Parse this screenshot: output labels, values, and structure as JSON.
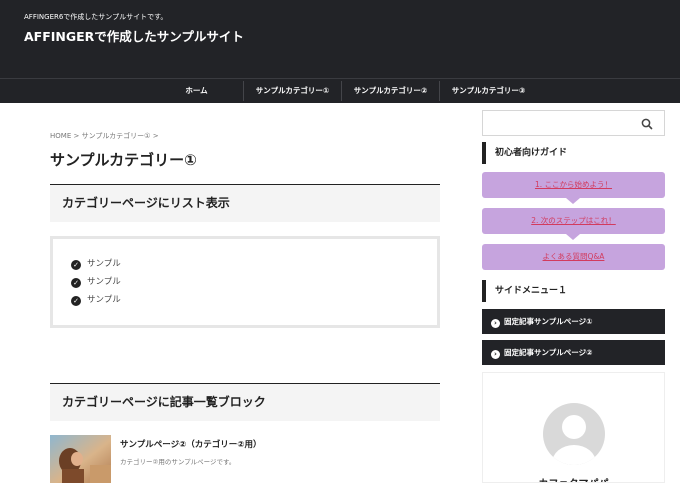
{
  "header": {
    "tagline": "AFFINGER6で作成したサンプルサイトです。",
    "site_title": "AFFINGERで作成したサンプルサイト",
    "bg_color": "#222327"
  },
  "nav": {
    "items": [
      {
        "label": "ホーム"
      },
      {
        "label": "サンプルカテゴリー①"
      },
      {
        "label": "サンプルカテゴリー②"
      },
      {
        "label": "サンプルカテゴリー③"
      }
    ]
  },
  "breadcrumb": {
    "items": [
      "HOME",
      "サンプルカテゴリー①"
    ],
    "separator": ">"
  },
  "main": {
    "category_title": "サンプルカテゴリー①",
    "section1_title": "カテゴリーページにリスト表示",
    "list_items": [
      "サンプル",
      "サンプル",
      "サンプル"
    ],
    "section2_title": "カテゴリーページに記事一覧ブロック",
    "post": {
      "title": "サンプルページ②（カテゴリー②用）",
      "excerpt": "カテゴリー②用のサンプルページです。"
    }
  },
  "sidebar": {
    "search_icon": "search-icon",
    "guide_heading": "初心者向けガイド",
    "guide_buttons": [
      "1. ここから始めよう！",
      "2. 次のステップはこれ！",
      "よくある質問Q&A"
    ],
    "guide_color": "#c6a4de",
    "guide_text_color": "#d23b5e",
    "menu_heading": "サイドメニュー１",
    "menu_items": [
      "固定記事サンプルページ①",
      "固定記事サンプルページ②"
    ],
    "profile_name": "カフェクマパパ"
  }
}
